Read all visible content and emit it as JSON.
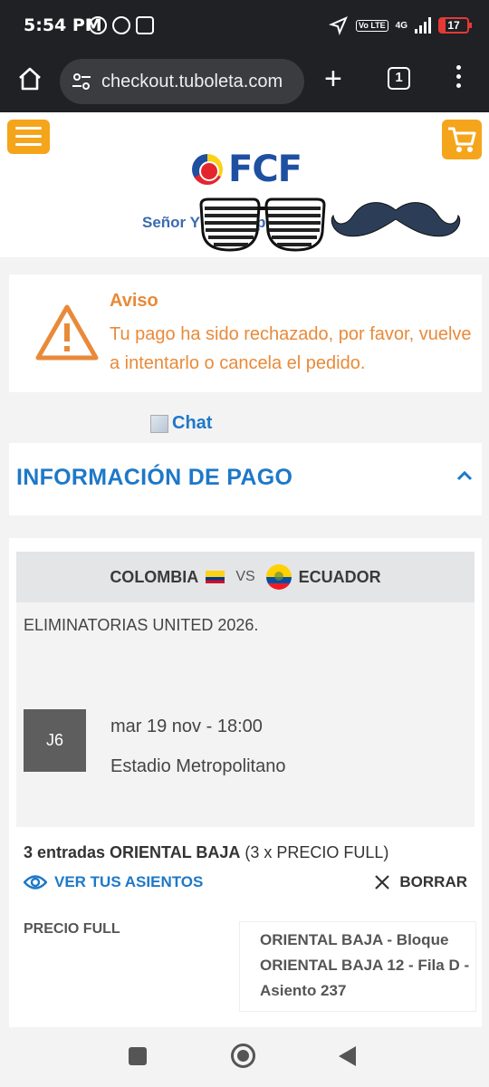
{
  "status_bar": {
    "time": "5:54 PM",
    "network": "4G",
    "volte": "Vo LTE",
    "battery": "17"
  },
  "browser": {
    "url": "checkout.tuboleta.com",
    "tab_count": "1"
  },
  "header": {
    "logo_text": "FCF",
    "greeting": "Señor Y           ej         M           Zapata"
  },
  "notice": {
    "title": "Aviso",
    "message": "Tu pago ha sido rechazado, por favor, vuelve a intentarlo o cancela el pedido."
  },
  "chat_image_alt": "Chat",
  "payment": {
    "section_title": "INFORMACIÓN DE PAGO",
    "home_team": "COLOMBIA",
    "vs": "VS",
    "away_team": "ECUADOR",
    "tournament": "ELIMINATORIAS UNITED 2026.",
    "matchday": "J6",
    "date": "mar 19 nov - 18:00",
    "venue": "Estadio Metropolitano",
    "tickets_bold": "3 entradas ORIENTAL BAJA",
    "tickets_detail": " (3 x PRECIO FULL)",
    "see_seats": "VER TUS ASIENTOS",
    "delete": "BORRAR",
    "price_type": "PRECIO FULL",
    "seat_info": "ORIENTAL BAJA - Bloque ORIENTAL BAJA 12 - Fila D - Asiento 237"
  },
  "colors": {
    "accent_blue": "#1e78c8",
    "warning_orange": "#e88a3a",
    "brand_yellow": "#f5a51b",
    "browser_dark": "#1f2124"
  }
}
